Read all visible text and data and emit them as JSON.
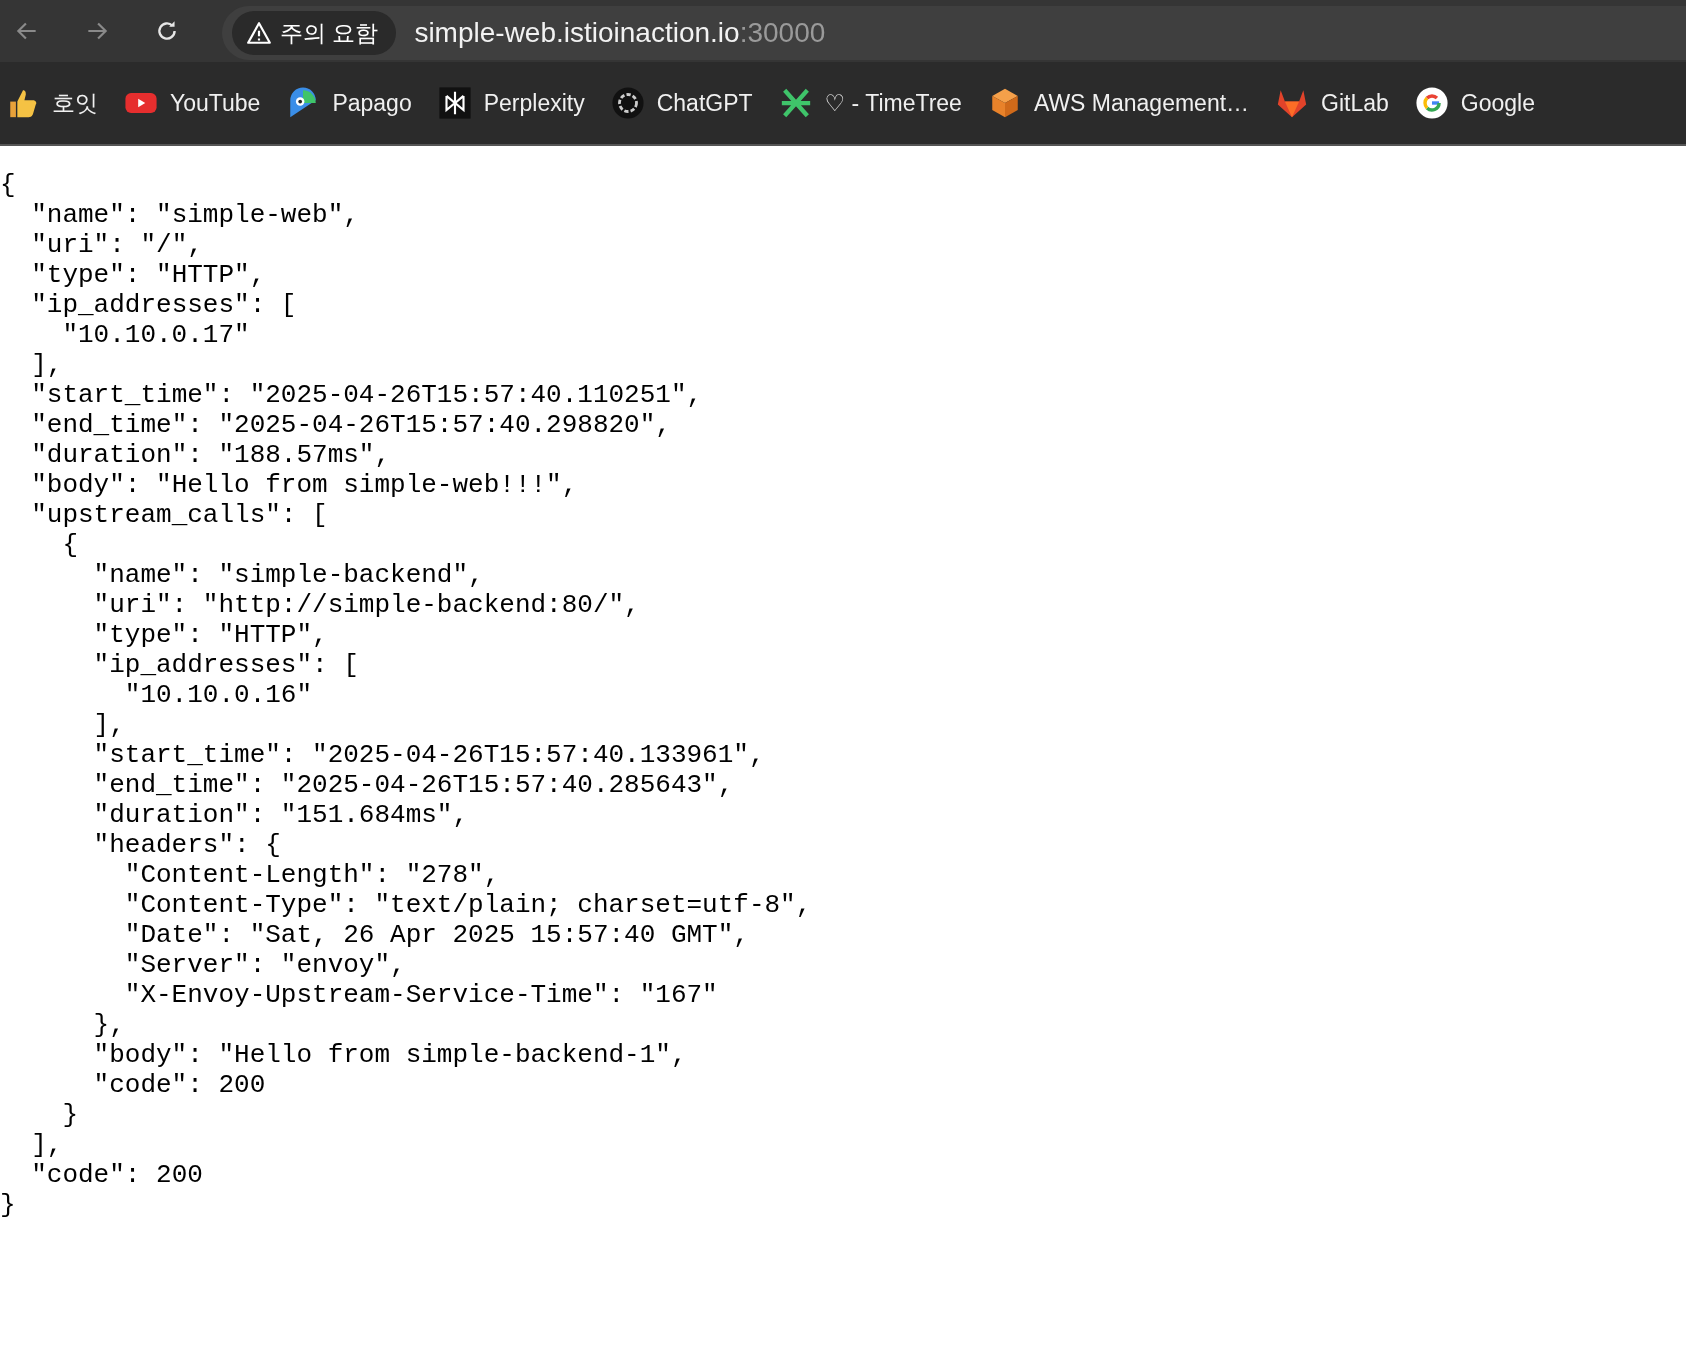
{
  "toolbar": {
    "security_chip": "주의 요함",
    "url_host": "simple-web.istioinaction.io",
    "url_port": ":30000"
  },
  "bookmarks": [
    {
      "label": "호잇",
      "kind": "thumbs"
    },
    {
      "label": "YouTube",
      "kind": "youtube"
    },
    {
      "label": "Papago",
      "kind": "papago"
    },
    {
      "label": "Perplexity",
      "kind": "perplexity"
    },
    {
      "label": "ChatGPT",
      "kind": "chatgpt"
    },
    {
      "label": "♡ - TimeTree",
      "kind": "timetree"
    },
    {
      "label": "AWS Management…",
      "kind": "aws"
    },
    {
      "label": "GitLab",
      "kind": "gitlab"
    },
    {
      "label": "Google",
      "kind": "google"
    }
  ],
  "document": [
    {
      "text": "{",
      "close": "}",
      "children": [
        {
          "text": "\"name\": \"simple-web\","
        },
        {
          "text": "\"uri\": \"/\","
        },
        {
          "text": "\"type\": \"HTTP\","
        },
        {
          "text": "\"ip_addresses\": [",
          "close": "],",
          "children": [
            {
              "text": "\"10.10.0.17\""
            }
          ]
        },
        {
          "text": "\"start_time\": \"2025-04-26T15:57:40.110251\","
        },
        {
          "text": "\"end_time\": \"2025-04-26T15:57:40.298820\","
        },
        {
          "text": "\"duration\": \"188.57ms\","
        },
        {
          "text": "\"body\": \"Hello from simple-web!!!\","
        },
        {
          "text": "\"upstream_calls\": [",
          "close": "],",
          "children": [
            {
              "text": "{",
              "close": "}",
              "children": [
                {
                  "text": "\"name\": \"simple-backend\","
                },
                {
                  "text": "\"uri\": \"http://simple-backend:80/\","
                },
                {
                  "text": "\"type\": \"HTTP\","
                },
                {
                  "text": "\"ip_addresses\": [",
                  "close": "],",
                  "children": [
                    {
                      "text": "\"10.10.0.16\""
                    }
                  ]
                },
                {
                  "text": "\"start_time\": \"2025-04-26T15:57:40.133961\","
                },
                {
                  "text": "\"end_time\": \"2025-04-26T15:57:40.285643\","
                },
                {
                  "text": "\"duration\": \"151.684ms\","
                },
                {
                  "text": "\"headers\": {",
                  "close": "},",
                  "children": [
                    {
                      "text": "\"Content-Length\": \"278\","
                    },
                    {
                      "text": "\"Content-Type\": \"text/plain; charset=utf-8\","
                    },
                    {
                      "text": "\"Date\": \"Sat, 26 Apr 2025 15:57:40 GMT\","
                    },
                    {
                      "text": "\"Server\": \"envoy\","
                    },
                    {
                      "text": "\"X-Envoy-Upstream-Service-Time\": \"167\""
                    }
                  ]
                },
                {
                  "text": "\"body\": \"Hello from simple-backend-1\","
                },
                {
                  "text": "\"code\": 200"
                }
              ]
            }
          ]
        },
        {
          "text": "\"code\": 200"
        }
      ]
    }
  ]
}
